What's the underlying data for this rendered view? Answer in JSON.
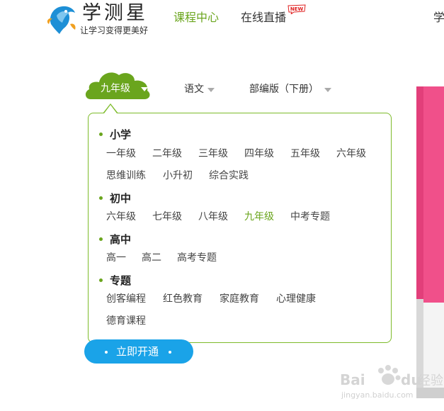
{
  "header": {
    "brand": "学测星",
    "slogan": "让学习变得更美好",
    "nav": [
      "课程中心",
      "在线直播",
      "学"
    ],
    "new_badge": "NEW"
  },
  "selectors": {
    "grade": "九年级",
    "subject": "语文",
    "edition": "部编版（下册）"
  },
  "dropdown": {
    "sections": [
      {
        "title": "小学",
        "items": [
          "一年级",
          "二年级",
          "三年级",
          "四年级",
          "五年级",
          "六年级",
          "思维训练",
          "小升初",
          "综合实践"
        ]
      },
      {
        "title": "初中",
        "items": [
          "六年级",
          "七年级",
          "八年级",
          "九年级",
          "中考专题"
        ]
      },
      {
        "title": "高中",
        "items": [
          "高一",
          "高二",
          "高考专题"
        ]
      },
      {
        "title": "专题",
        "items": [
          "创客编程",
          "红色教育",
          "家庭教育",
          "心理健康",
          "德育课程"
        ]
      }
    ],
    "active_item": "九年级"
  },
  "cta": {
    "label": "立即开通"
  },
  "colors": {
    "accent_green": "#6aa51d",
    "border_green": "#7dbb2a",
    "button_blue": "#1aa3e8",
    "book_pink": "#f0508a"
  },
  "icons": [
    "dolphin-logo-icon",
    "new-badge-icon",
    "chevron-down-icon",
    "baidu-paw-icon"
  ],
  "watermark": {
    "brand": "Bai",
    "brand2": "du",
    "cn": "经验",
    "url": "jingyan.baidu.com"
  }
}
